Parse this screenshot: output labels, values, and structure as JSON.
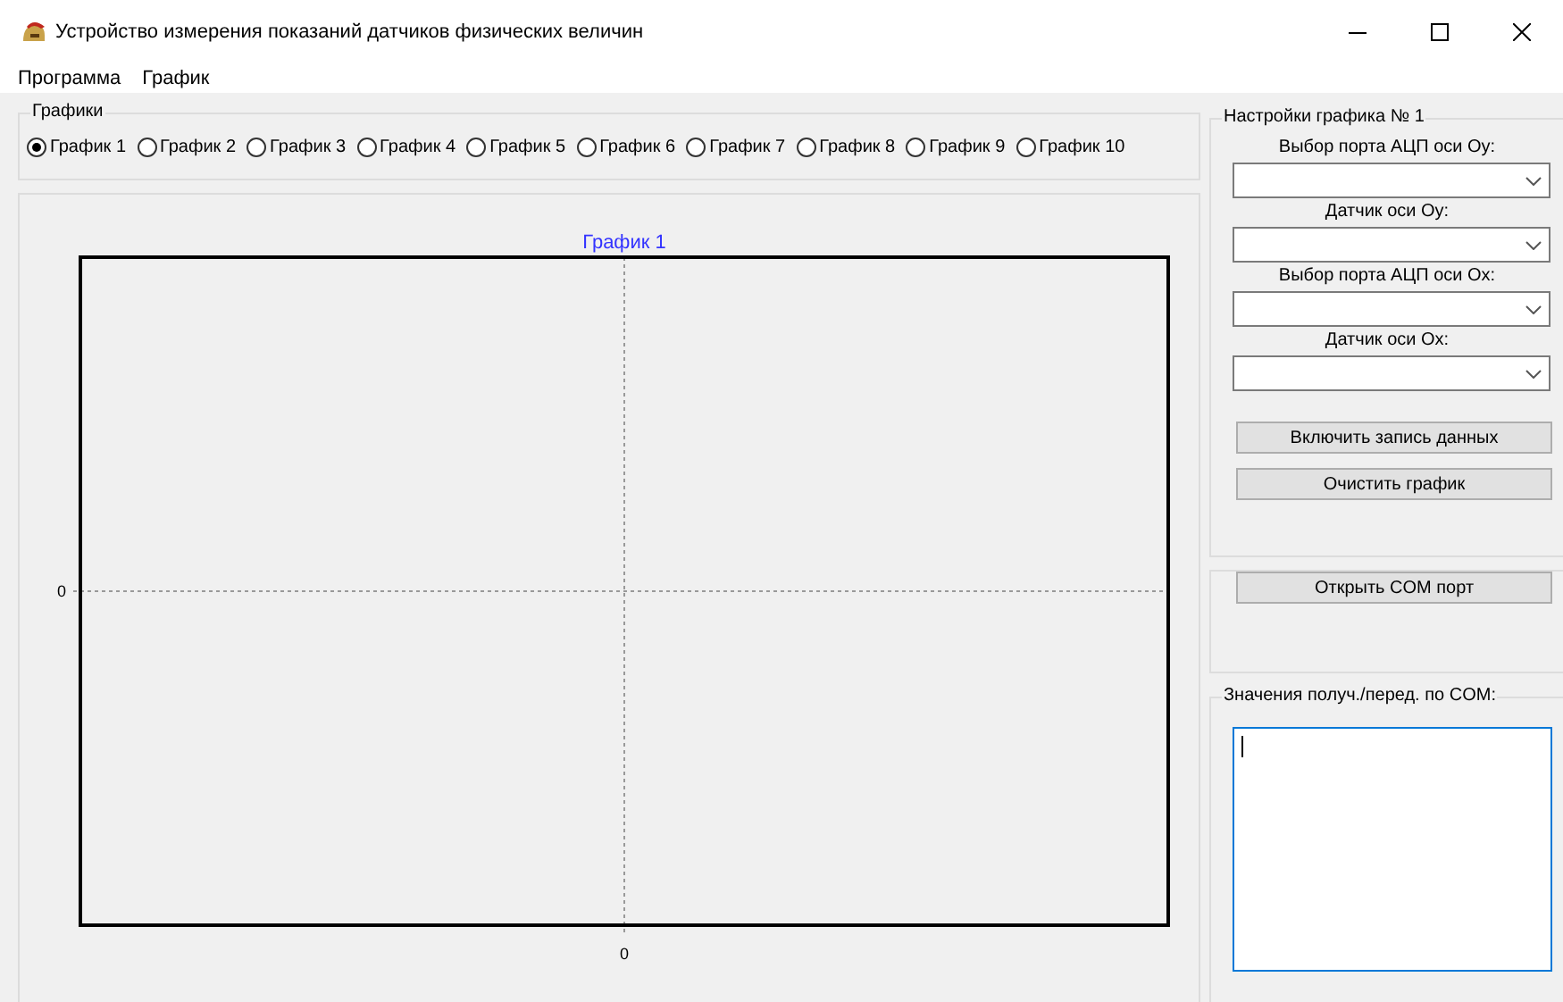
{
  "window": {
    "title": "Устройство измерения показаний датчиков физических величин"
  },
  "menu": [
    "Программа",
    "График"
  ],
  "graphs_group": {
    "title": "Графики",
    "options": [
      {
        "label": "График 1",
        "selected": true
      },
      {
        "label": "График 2",
        "selected": false
      },
      {
        "label": "График 3",
        "selected": false
      },
      {
        "label": "График 4",
        "selected": false
      },
      {
        "label": "График 5",
        "selected": false
      },
      {
        "label": "График 6",
        "selected": false
      },
      {
        "label": "График 7",
        "selected": false
      },
      {
        "label": "График 8",
        "selected": false
      },
      {
        "label": "График 9",
        "selected": false
      },
      {
        "label": "График 10",
        "selected": false
      }
    ]
  },
  "chart": {
    "title": "График 1",
    "x_axis_label": "0",
    "y_axis_label": "0"
  },
  "settings": {
    "title": "Настройки графика № 1",
    "fields": [
      {
        "label": "Выбор порта АЦП оси Oy:"
      },
      {
        "label": "Датчик оси Oy:"
      },
      {
        "label": "Выбор порта АЦП оси Ox:"
      },
      {
        "label": "Датчик оси Ox:"
      }
    ],
    "buttons": [
      "Включить запись данных",
      "Очистить график"
    ]
  },
  "com": {
    "button": "Открыть COM порт"
  },
  "log": {
    "title": "Значения получ./перед. по COM:"
  }
}
